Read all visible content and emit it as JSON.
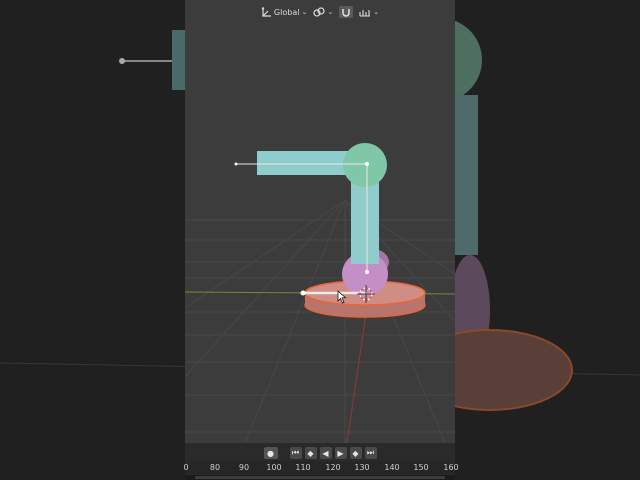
{
  "header": {
    "orientation_label": "Global",
    "icons": [
      "transform-orientation-icon",
      "pivot-link-icon",
      "snap-magnet-icon",
      "snap-increment-icon"
    ]
  },
  "timeline": {
    "controls": [
      "record-icon",
      "jump-start-icon",
      "prev-keyframe-icon",
      "play-reverse-icon",
      "play-icon",
      "next-keyframe-icon",
      "jump-end-icon"
    ],
    "ruler_ticks": [
      "0",
      "80",
      "90",
      "100",
      "110",
      "120",
      "130",
      "140",
      "150",
      "160"
    ]
  },
  "colors": {
    "bone_green": "#7fc7a6",
    "bone_cyan": "#8fcccc",
    "bone_pink": "#c48fc4",
    "base_disc": "#d08d83",
    "selection_outline": "#e8643c",
    "viewport_bg": "#3c3c3c"
  }
}
